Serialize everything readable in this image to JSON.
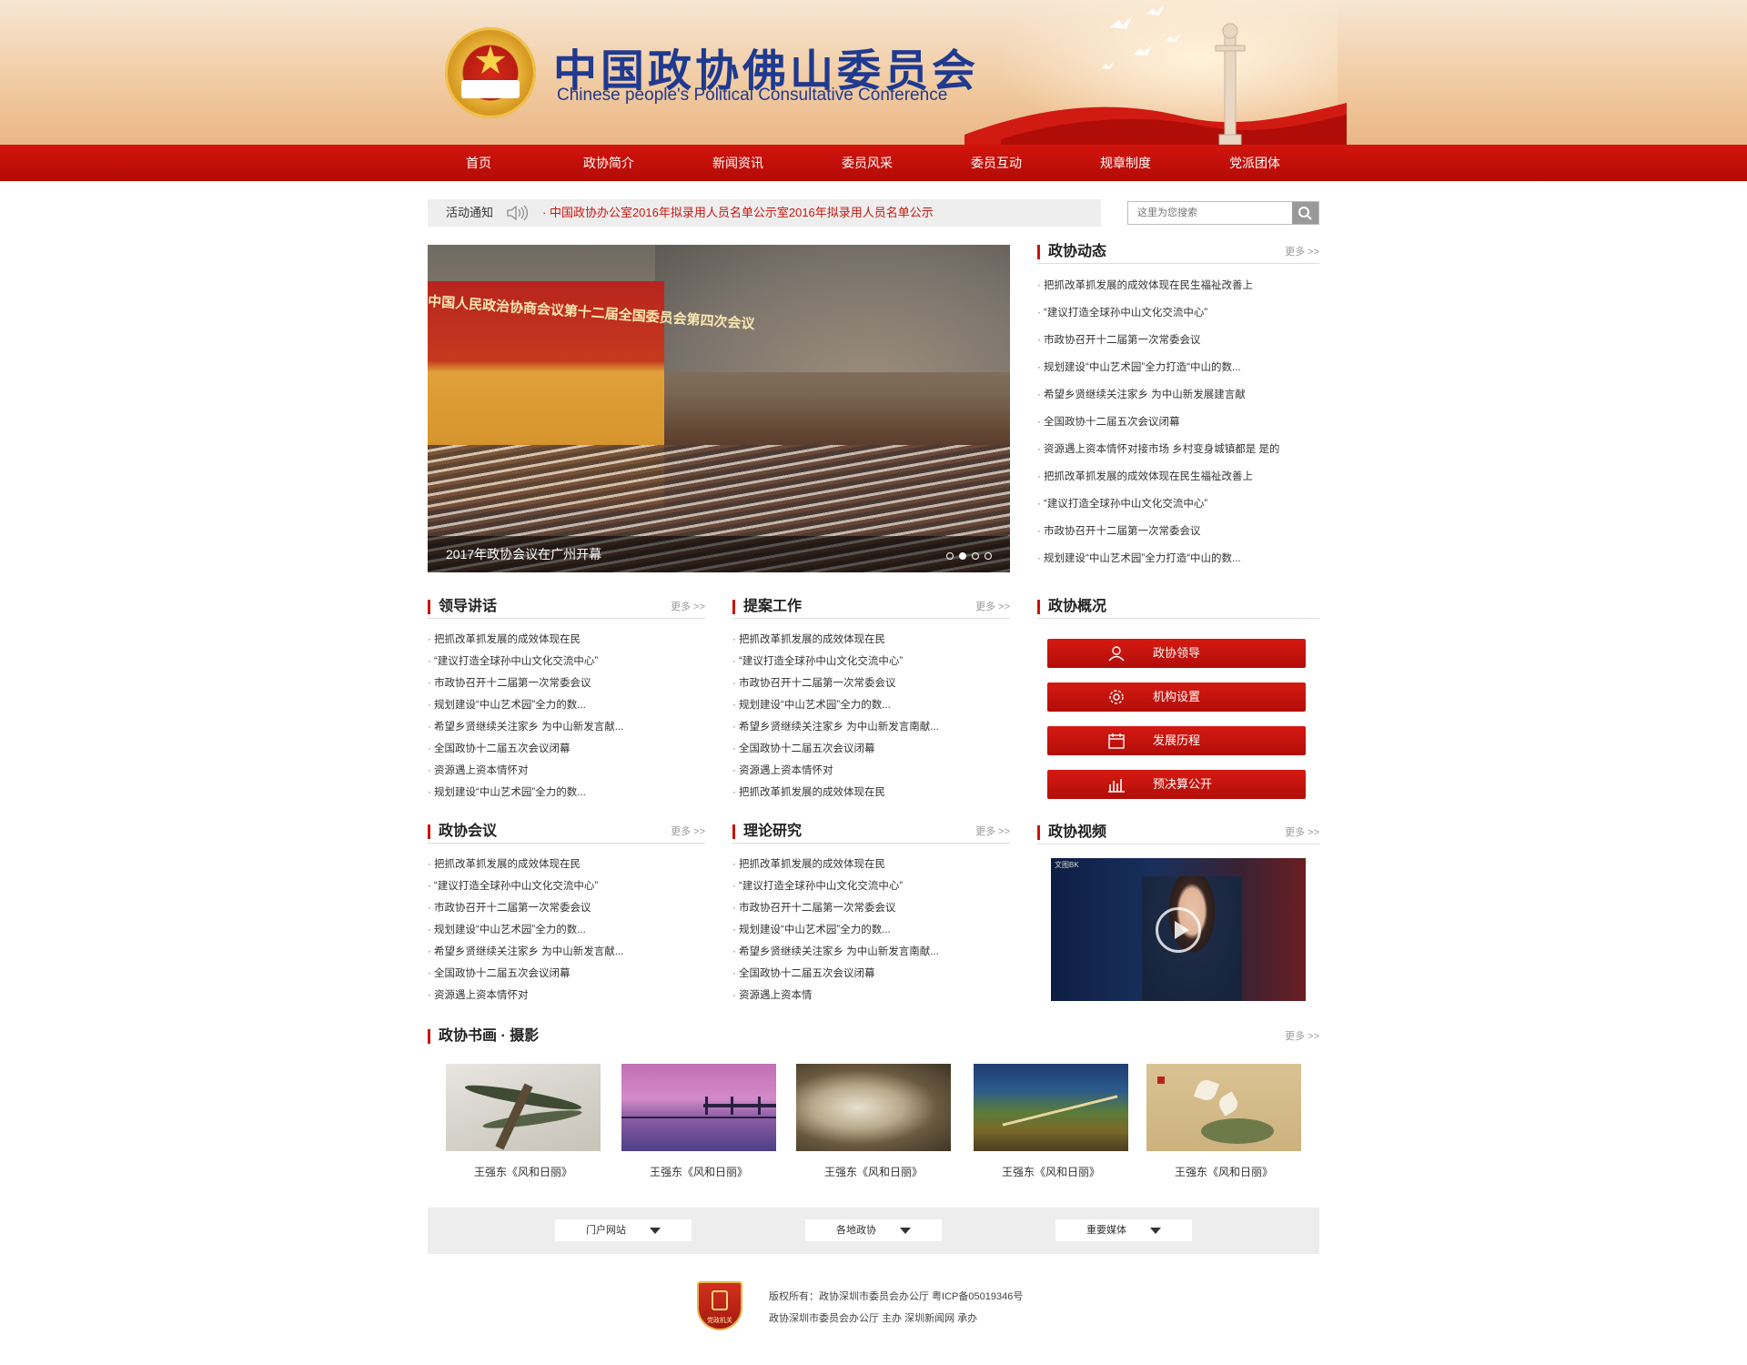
{
  "header": {
    "title_cn": "中国政协佛山委员会",
    "title_en": "Chinese people's Political Consultative Conference"
  },
  "nav": [
    "首页",
    "政协简介",
    "新闻资讯",
    "委员风采",
    "委员互动",
    "规章制度",
    "党派团体"
  ],
  "notice": {
    "label": "活动通知",
    "message": "· 中国政协办公室2016年拟录用人员名单公示室2016年拟录用人员名单公示"
  },
  "search": {
    "placeholder": "这里为您搜索"
  },
  "slider": {
    "caption": "2017年政协会议在广州开幕",
    "banner_text": "中国人民政治协商会议第十二届全国委员会第四次会议",
    "active_dot": 2,
    "dot_count": 4
  },
  "more_label": "更多 >>",
  "news": {
    "title": "政协动态",
    "items": [
      "把抓改革抓发展的成效体现在民生福祉改善上",
      "“建议打造全球孙中山文化交流中心”",
      "市政协召开十二届第一次常委会议",
      "规划建设“中山艺术园”全力打造“中山的数...",
      "希望乡贤继续关注家乡 为中山新发展建言献",
      "全国政协十二届五次会议闭幕",
      "资源遇上资本情怀对接市场 乡村变身城镇都是 是的",
      "把抓改革抓发展的成效体现在民生福祉改善上",
      "“建议打造全球孙中山文化交流中心”",
      "市政协召开十二届第一次常委会议",
      "规划建设“中山艺术园”全力打造“中山的数..."
    ]
  },
  "leader": {
    "title": "领导讲话",
    "items": [
      "把抓改革抓发展的成效体现在民",
      "“建议打造全球孙中山文化交流中心”",
      "市政协召开十二届第一次常委会议",
      "规划建设“中山艺术园”全力的数...",
      "希望乡贤继续关注家乡 为中山新发言献...",
      "全国政协十二届五次会议闭幕",
      "资源遇上资本情怀对",
      "规划建设“中山艺术园”全力的数..."
    ]
  },
  "proposal": {
    "title": "提案工作",
    "items": [
      "把抓改革抓发展的成效体现在民",
      "“建议打造全球孙中山文化交流中心”",
      "市政协召开十二届第一次常委会议",
      "规划建设“中山艺术园”全力的数...",
      "希望乡贤继续关注家乡 为中山新发言南献...",
      "全国政协十二届五次会议闭幕",
      "资源遇上资本情怀对",
      "把抓改革抓发展的成效体现在民"
    ]
  },
  "meeting": {
    "title": "政协会议",
    "items": [
      "把抓改革抓发展的成效体现在民",
      "“建议打造全球孙中山文化交流中心”",
      "市政协召开十二届第一次常委会议",
      "规划建设“中山艺术园”全力的数...",
      "希望乡贤继续关注家乡 为中山新发言献...",
      "全国政协十二届五次会议闭幕",
      "资源遇上资本情怀对"
    ]
  },
  "theory": {
    "title": "理论研究",
    "items": [
      "把抓改革抓发展的成效体现在民",
      "“建议打造全球孙中山文化交流中心”",
      "市政协召开十二届第一次常委会议",
      "规划建设“中山艺术园”全力的数...",
      "希望乡贤继续关注家乡 为中山新发言南献...",
      "全国政协十二届五次会议闭幕",
      "资源遇上资本情"
    ]
  },
  "overview": {
    "title": "政协概况",
    "buttons": [
      {
        "label": "政协领导",
        "icon": "user-icon"
      },
      {
        "label": "机构设置",
        "icon": "gear-icon"
      },
      {
        "label": "发展历程",
        "icon": "calendar-icon"
      },
      {
        "label": "预决算公开",
        "icon": "bar-chart-icon"
      }
    ]
  },
  "video": {
    "title": "政协视频",
    "tag": "文图BK"
  },
  "gallery": {
    "title": "政协书画 · 摄影",
    "items": [
      {
        "caption": "王强东《风和日丽》",
        "image": "pine-tree-painting"
      },
      {
        "caption": "王强东《风和日丽》",
        "image": "lake-pier-sunset"
      },
      {
        "caption": "王强东《风和日丽》",
        "image": "rock-painting"
      },
      {
        "caption": "王强东《风和日丽》",
        "image": "coastal-road-aerial"
      },
      {
        "caption": "王强东《风和日丽》",
        "image": "lily-flower-painting"
      }
    ]
  },
  "links": [
    "门户网站",
    "各地政协",
    "重要媒体"
  ],
  "footer": {
    "badge_text": "党政机关",
    "line1": "版权所有：政协深圳市委员会办公厅  粤ICP备05019346号",
    "line2": "政协深圳市委员会办公厅 主办  深圳新闻网 承办"
  }
}
